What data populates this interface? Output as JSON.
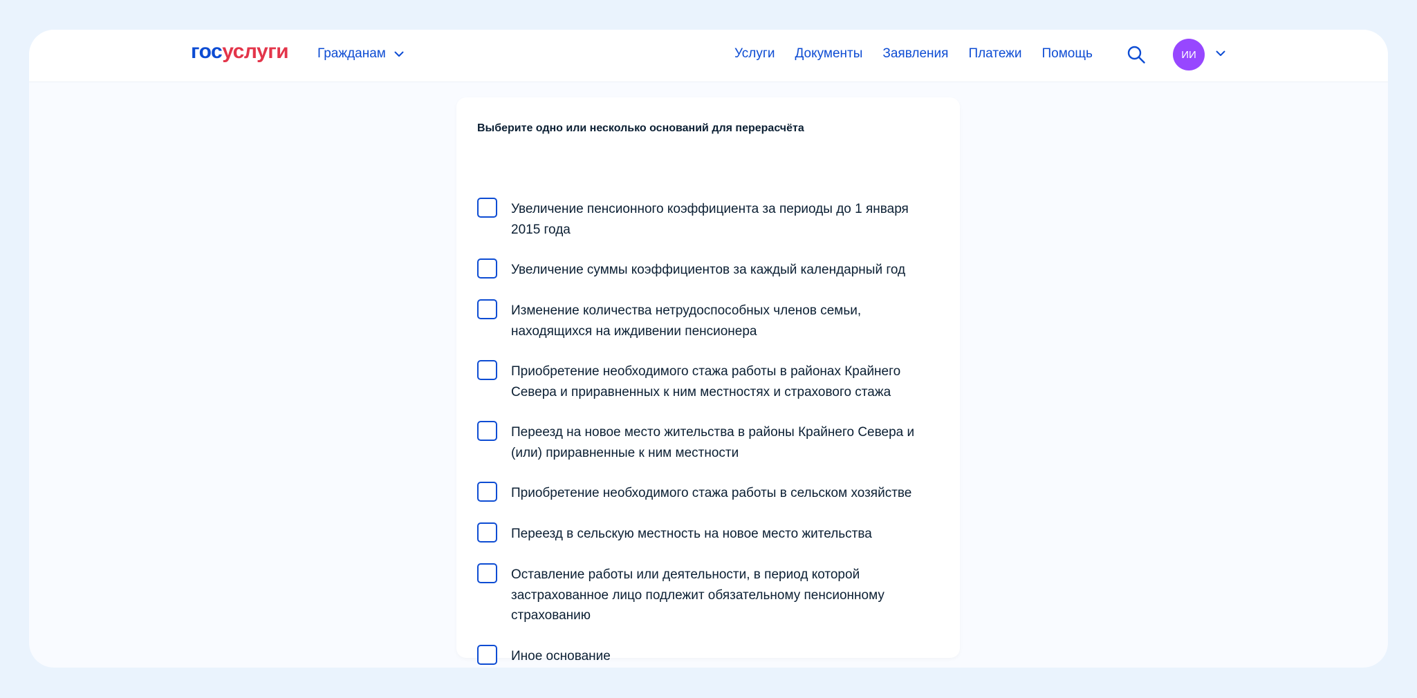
{
  "header": {
    "logo_part1": "гос",
    "logo_part2": "услуги",
    "audience_label": "Гражданам",
    "nav": [
      "Услуги",
      "Документы",
      "Заявления",
      "Платежи",
      "Помощь"
    ],
    "avatar_initials": "ИИ"
  },
  "form": {
    "title": "Выберите одно или несколько оснований для перерасчёта",
    "options": [
      "Увеличение пенсионного коэффициента за периоды до 1 января 2015 года",
      "Увеличение суммы коэффициентов за каждый календарный год",
      "Изменение количества нетрудоспособных членов семьи, находящихся на иждивении пенсионера",
      "Приобретение необходимого стажа работы в районах Крайнего Севера и приравненных к ним местностях и страхового стажа",
      "Переезд на новое место жительства в районы Крайнего Севера и (или) приравненные к ним местности",
      "Приобретение необходимого стажа работы в сельском хозяйстве",
      "Переезд в сельскую местность на новое место жительства",
      "Оставление работы или деятельности, в период которой застрахованное лицо подлежит обязательному пенсионному страхованию",
      "Иное основание"
    ]
  },
  "colors": {
    "brand_blue": "#0d4cd3",
    "brand_red": "#e3354a",
    "avatar_bg": "#9747ff",
    "text": "#0b1f33"
  },
  "icons": {
    "search": "search-icon",
    "chevron": "chevron-down-icon",
    "checkbox": "checkbox-icon"
  }
}
